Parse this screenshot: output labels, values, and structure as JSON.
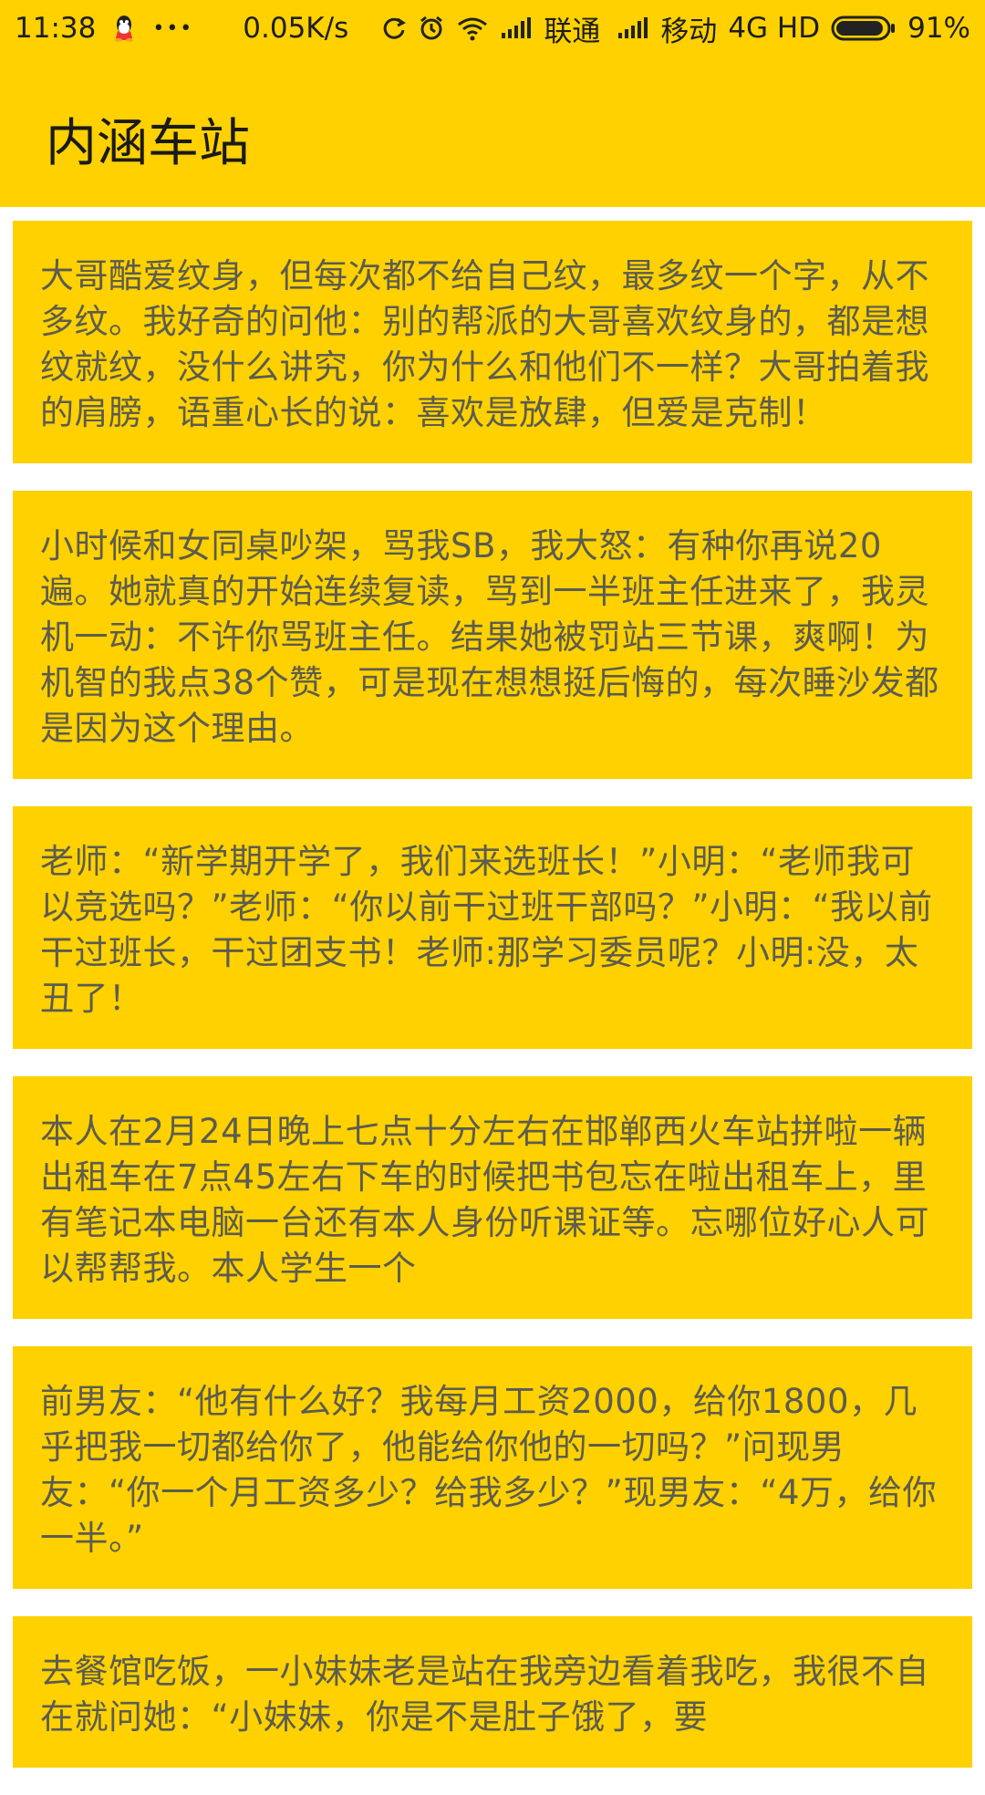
{
  "status_bar": {
    "time": "11:38",
    "more": "•••",
    "net_speed": "0.05K/s",
    "carrier1": "联通",
    "carrier2": "移动",
    "network": "4G HD",
    "battery": "91%",
    "battery_level": 0.91,
    "icons": [
      "qq-icon",
      "sync-icon",
      "alarm-icon",
      "wifi-icon",
      "signal-icon",
      "battery-icon"
    ]
  },
  "appbar": {
    "title": "内涵车站"
  },
  "jokes": [
    "大哥酷爱纹身，但每次都不给自己纹，最多纹一个字，从不多纹。我好奇的问他：别的帮派的大哥喜欢纹身的，都是想纹就纹，没什么讲究，你为什么和他们不一样？大哥拍着我的肩膀，语重心长的说：喜欢是放肆，但爱是克制！",
    "小时候和女同桌吵架，骂我SB，我大怒：有种你再说20遍。她就真的开始连续复读，骂到一半班主任进来了，我灵机一动：不许你骂班主任。结果她被罚站三节课，爽啊！为机智的我点38个赞，可是现在想想挺后悔的，每次睡沙发都是因为这个理由。",
    "老师：“新学期开学了，我们来选班长！”小明：“老师我可以竞选吗？”老师：“你以前干过班干部吗？”小明：“我以前干过班长，干过团支书！老师:那学习委员呢？小明:没，太丑了！",
    "本人在2月24日晚上七点十分左右在邯郸西火车站拼啦一辆出租车在7点45左右下车的时候把书包忘在啦出租车上，里有笔记本电脑一台还有本人身份听课证等。忘哪位好心人可以帮帮我。本人学生一个",
    "前男友：“他有什么好？我每月工资2000，给你1800，几乎把我一切都给你了，他能给你他的一切吗？”问现男友：“你一个月工资多少？给我多少？”现男友：“4万，给你一半。”",
    "去餐馆吃饭，一小妹妹老是站在我旁边看着我吃，我很不自在就问她：“小妹妹，你是不是肚子饿了，要"
  ],
  "colors": {
    "accent": "#FFD100",
    "text": "#5c5c4f"
  }
}
